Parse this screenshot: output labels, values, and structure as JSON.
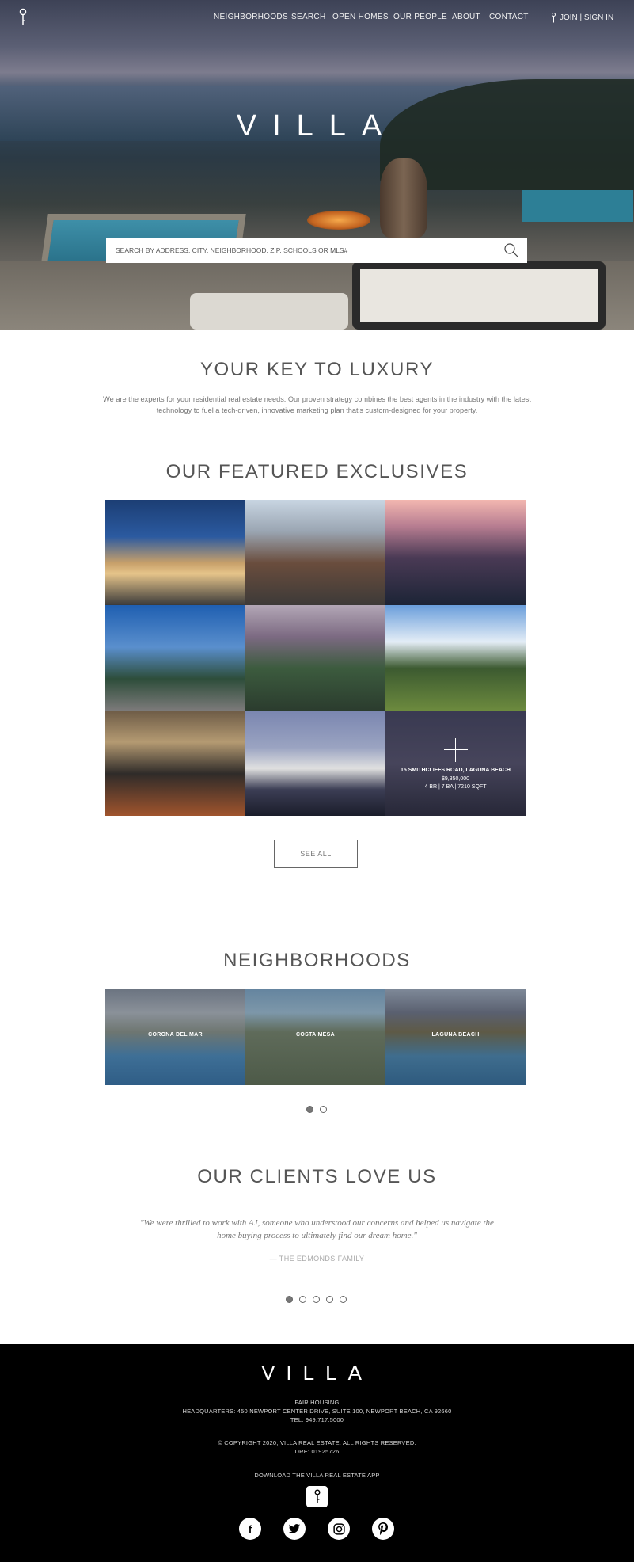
{
  "header": {
    "nav": [
      "NEIGHBORHOODS",
      "SEARCH",
      "OPEN HOMES",
      "OUR PEOPLE",
      "ABOUT",
      "CONTACT"
    ],
    "join": "JOIN | SIGN IN"
  },
  "hero": {
    "logo": "VILLA",
    "search_placeholder": "SEARCH BY ADDRESS, CITY, NEIGHBORHOOD, ZIP, SCHOOLS OR MLS#"
  },
  "intro": {
    "title": "YOUR KEY TO LUXURY",
    "text": "We are the experts for your residential real estate needs. Our proven strategy combines the best agents in the industry with the latest technology to fuel a tech-driven, innovative marketing plan that's custom-designed for your property."
  },
  "featured": {
    "title": "OUR FEATURED EXCLUSIVES",
    "hover": {
      "address": "15 SMITHCLIFFS ROAD, LAGUNA BEACH",
      "price": "$9,350,000",
      "details": "4 BR | 7 BA | 7210 SQFT"
    },
    "see_all": "SEE ALL"
  },
  "neighborhoods": {
    "title": "NEIGHBORHOODS",
    "items": [
      "CORONA DEL MAR",
      "COSTA MESA",
      "LAGUNA BEACH"
    ]
  },
  "testimonials": {
    "title": "OUR CLIENTS LOVE US",
    "quote": "\"We were thrilled to work with AJ, someone who understood our concerns and helped us navigate the home buying process to ultimately find our dream home.\"",
    "author": "— THE EDMONDS FAMILY"
  },
  "footer": {
    "logo": "VILLA",
    "fair_housing": "FAIR HOUSING",
    "hq": "HEADQUARTERS: 450 NEWPORT CENTER DRIVE, SUITE 100, NEWPORT BEACH, CA 92660",
    "tel": "TEL: 949.717.5000",
    "copyright": "© COPYRIGHT 2020, VILLA REAL ESTATE. ALL RIGHTS RESERVED.",
    "dre": "DRE: 01925726",
    "app": "DOWNLOAD THE VILLA REAL ESTATE APP",
    "social": {
      "facebook": "f"
    }
  },
  "colors": {
    "footer_bg": "#000000",
    "text": "#555555"
  }
}
